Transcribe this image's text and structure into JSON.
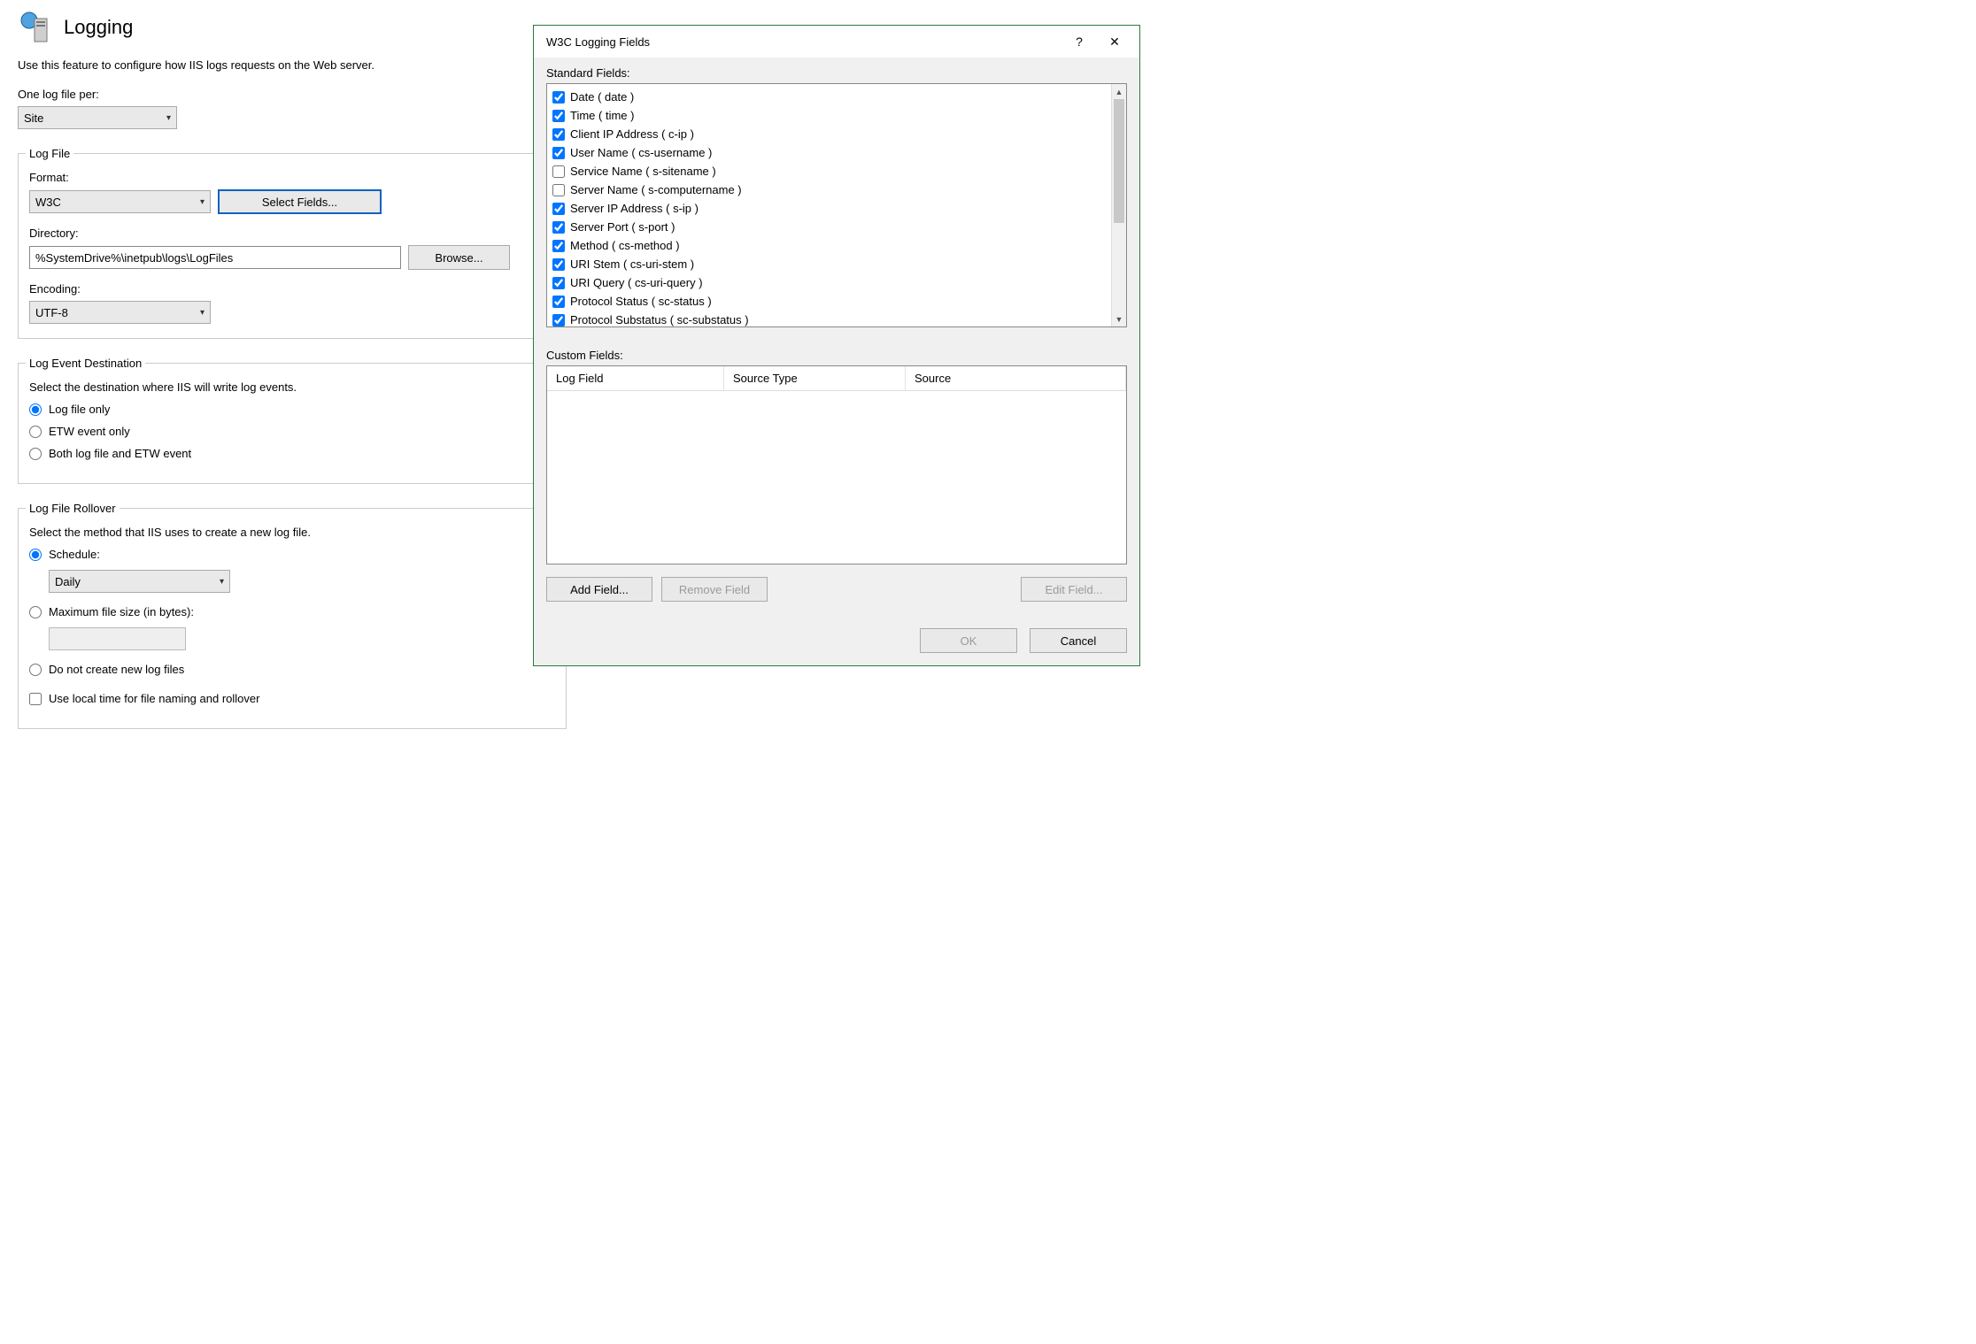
{
  "page": {
    "title": "Logging",
    "description": "Use this feature to configure how IIS logs requests on the Web server.",
    "one_log_file_per_label": "One log file per:",
    "one_log_file_per_value": "Site"
  },
  "log_file": {
    "legend": "Log File",
    "format_label": "Format:",
    "format_value": "W3C",
    "select_fields_label": "Select Fields...",
    "directory_label": "Directory:",
    "directory_value": "%SystemDrive%\\inetpub\\logs\\LogFiles",
    "browse_label": "Browse...",
    "encoding_label": "Encoding:",
    "encoding_value": "UTF-8"
  },
  "log_event_destination": {
    "legend": "Log Event Destination",
    "desc": "Select the destination where IIS will write log events.",
    "options": {
      "log_file_only": "Log file only",
      "etw_only": "ETW event only",
      "both": "Both log file and ETW event"
    },
    "selected": "log_file_only"
  },
  "log_file_rollover": {
    "legend": "Log File Rollover",
    "desc": "Select the method that IIS uses to create a new log file.",
    "schedule_label": "Schedule:",
    "schedule_value": "Daily",
    "max_size_label": "Maximum file size (in bytes):",
    "max_size_value": "",
    "no_new_label": "Do not create new log files",
    "local_time_label": "Use local time for file naming and rollover",
    "selected": "schedule"
  },
  "dialog": {
    "title": "W3C Logging Fields",
    "standard_fields_label": "Standard Fields:",
    "standard_fields": [
      {
        "label": "Date ( date )",
        "checked": true
      },
      {
        "label": "Time ( time )",
        "checked": true
      },
      {
        "label": "Client IP Address ( c-ip )",
        "checked": true
      },
      {
        "label": "User Name ( cs-username )",
        "checked": true
      },
      {
        "label": "Service Name ( s-sitename )",
        "checked": false
      },
      {
        "label": "Server Name ( s-computername )",
        "checked": false
      },
      {
        "label": "Server IP Address ( s-ip )",
        "checked": true
      },
      {
        "label": "Server Port ( s-port )",
        "checked": true
      },
      {
        "label": "Method ( cs-method )",
        "checked": true
      },
      {
        "label": "URI Stem ( cs-uri-stem )",
        "checked": true
      },
      {
        "label": "URI Query ( cs-uri-query )",
        "checked": true
      },
      {
        "label": "Protocol Status ( sc-status )",
        "checked": true
      },
      {
        "label": "Protocol Substatus ( sc-substatus )",
        "checked": true
      }
    ],
    "custom_fields_label": "Custom Fields:",
    "columns": {
      "log_field": "Log Field",
      "source_type": "Source Type",
      "source": "Source"
    },
    "add_field_label": "Add Field...",
    "remove_field_label": "Remove Field",
    "edit_field_label": "Edit Field...",
    "ok_label": "OK",
    "cancel_label": "Cancel"
  }
}
